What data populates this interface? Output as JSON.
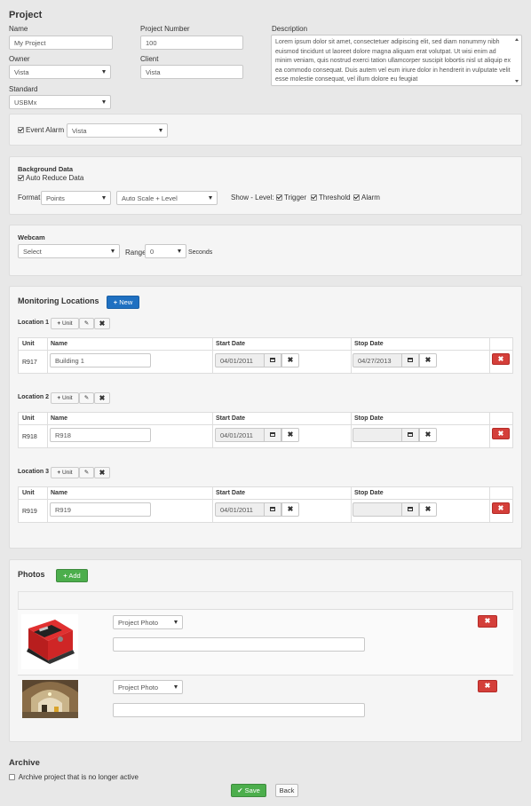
{
  "project": {
    "heading": "Project",
    "name_label": "Name",
    "name_value": "My Project",
    "number_label": "Project Number",
    "number_value": "100",
    "description_label": "Description",
    "description_value": "Lorem ipsum dolor sit amet, consectetuer adipiscing elit, sed diam nonummy nibh euismod tincidunt ut laoreet dolore magna aliquam erat volutpat. Ut wisi enim ad minim veniam, quis nostrud exerci tation ullamcorper suscipit lobortis nisl ut aliquip ex ea commodo consequat. Duis autem vel eum iriure dolor in hendrerit in vulputate velit esse molestie consequat, vel illum dolore eu feugiat",
    "owner_label": "Owner",
    "owner_value": "Vista",
    "client_label": "Client",
    "client_value": "Vista",
    "standard_label": "Standard",
    "standard_value": "USBMx"
  },
  "event_alarm": {
    "label": "Event Alarm",
    "checked": true,
    "select_value": "Vista"
  },
  "background_data": {
    "heading": "Background Data",
    "auto_reduce_label": "Auto Reduce Data",
    "format_label": "Format",
    "format_value": "Points",
    "scale_value": "Auto Scale + Level",
    "show_level_label": "Show - Level:",
    "trigger_label": "Trigger",
    "threshold_label": "Threshold",
    "alarm_label": "Alarm"
  },
  "webcam": {
    "heading": "Webcam",
    "select_value": "Select",
    "range_label": "Range",
    "range_value": "0",
    "seconds_label": "Seconds"
  },
  "monitoring": {
    "heading": "Monitoring Locations",
    "new_button": "New",
    "unit_button": "Unit",
    "col_unit": "Unit",
    "col_name": "Name",
    "col_start": "Start Date",
    "col_stop": "Stop Date",
    "locations": [
      {
        "label": "Location 1",
        "unit": "R917",
        "name": "Building 1",
        "start": "04/01/2011",
        "stop": "04/27/2013"
      },
      {
        "label": "Location 2",
        "unit": "R918",
        "name": "R918",
        "start": "04/01/2011",
        "stop": ""
      },
      {
        "label": "Location 3",
        "unit": "R919",
        "name": "R919",
        "start": "04/01/2011",
        "stop": ""
      }
    ]
  },
  "photos": {
    "heading": "Photos",
    "add_button": "Add",
    "items": [
      {
        "type": "Project Photo",
        "caption": ""
      },
      {
        "type": "Project Photo",
        "caption": ""
      }
    ]
  },
  "archive": {
    "heading": "Archive",
    "checkbox_label": "Archive project that is no longer active"
  },
  "footer": {
    "save_button": "Save",
    "back_button": "Back"
  },
  "colors": {
    "primary": "#1f70c1",
    "success": "#4cae4c",
    "danger": "#d43f3a",
    "background": "#e8e8e8",
    "panel": "#f5f5f5"
  }
}
